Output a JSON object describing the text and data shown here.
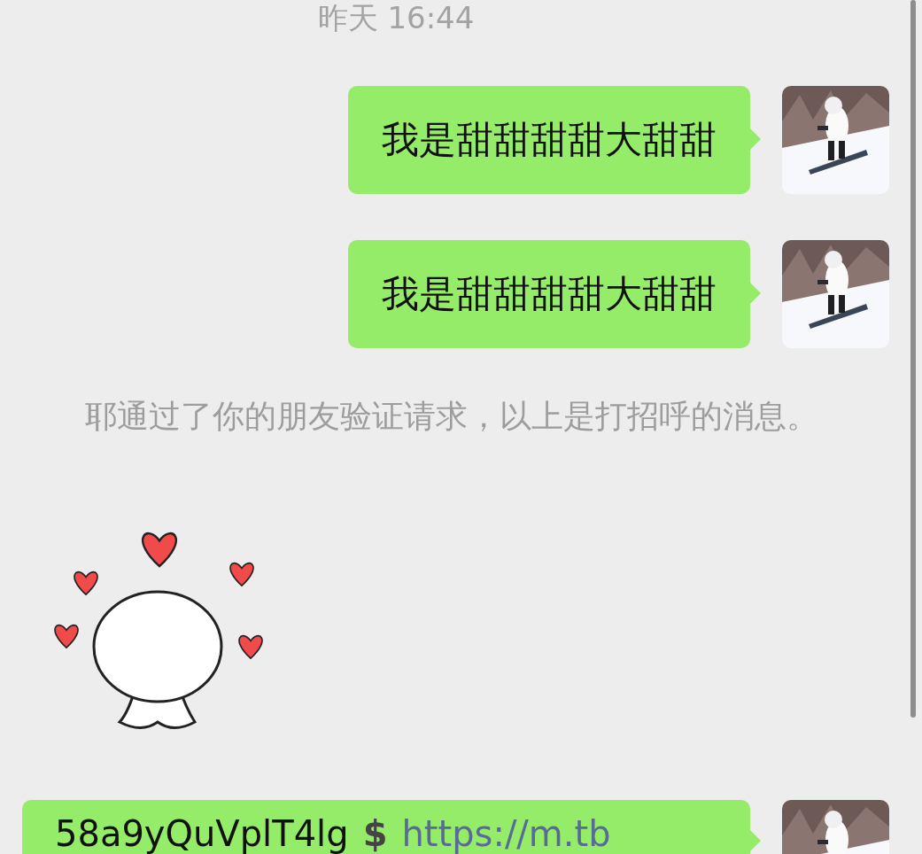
{
  "timestamp": "昨天 16:44",
  "messages": [
    {
      "kind": "text",
      "text": "我是甜甜甜甜大甜甜"
    },
    {
      "kind": "text",
      "text": "我是甜甜甜甜大甜甜"
    },
    {
      "kind": "system",
      "text": "耶通过了你的朋友验证请求，以上是打招呼的消息。"
    },
    {
      "kind": "sticker"
    },
    {
      "kind": "link",
      "code": "58a9yQuVplT4lg",
      "symbol": "$",
      "url": "https://m.tb"
    }
  ]
}
